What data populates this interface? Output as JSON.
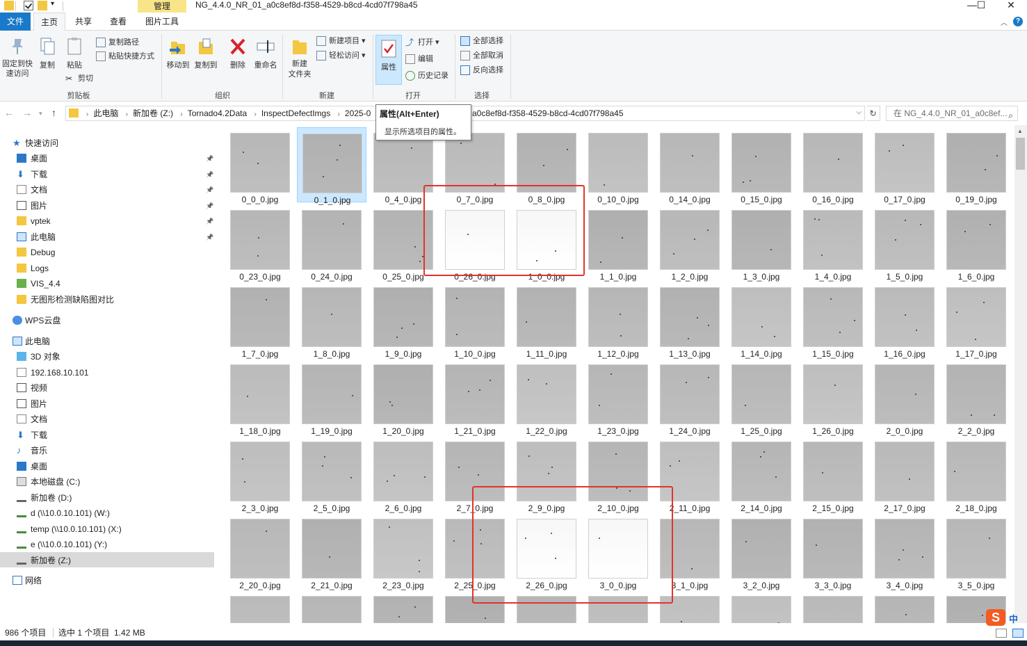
{
  "titlebar": {
    "manage_tab": "管理",
    "title": "NG_4.4.0_NR_01_a0c8ef8d-f358-4529-b8cd-4cd07f798a45",
    "minimize": "—",
    "maximize": "☐",
    "close": "✕"
  },
  "tabs": {
    "file": "文件",
    "home": "主页",
    "share": "共享",
    "view": "查看",
    "picture_tools": "图片工具"
  },
  "ribbon": {
    "pin_quick": "固定到快\n速访问",
    "copy": "复制",
    "paste": "粘贴",
    "copy_path": "复制路径",
    "paste_shortcut": "粘贴快捷方式",
    "cut": "剪切",
    "group_clipboard": "剪贴板",
    "move_to": "移动到",
    "copy_to": "复制到",
    "delete": "删除",
    "rename": "重命名",
    "group_organize": "组织",
    "new_folder": "新建\n文件夹",
    "new_item": "新建项目",
    "easy_access": "轻松访问",
    "group_new": "新建",
    "properties": "属性",
    "open": "打开",
    "edit": "编辑",
    "history": "历史记录",
    "group_open": "打开",
    "select_all": "全部选择",
    "select_none": "全部取消",
    "invert_selection": "反向选择",
    "group_select": "选择"
  },
  "address": {
    "crumbs": [
      "此电脑",
      "新加卷 (Z:)",
      "Tornado4.2Data",
      "InspectDefectImgs",
      "2025-0"
    ],
    "tail": "a0c8ef8d-f358-4529-b8cd-4cd07f798a45",
    "search_placeholder": "在 NG_4.4.0_NR_01_a0c8ef..."
  },
  "tooltip": {
    "title": "属性(Alt+Enter)",
    "desc": "显示所选项目的属性。"
  },
  "navpane": {
    "quick_access": "快速访问",
    "quick_items": [
      "桌面",
      "下载",
      "文档",
      "图片",
      "vptek",
      "此电脑",
      "Debug",
      "Logs",
      "VIS_4.4",
      "无图形检测缺陷图对比"
    ],
    "wps": "WPS云盘",
    "this_pc": "此电脑",
    "pc_items": [
      "3D 对象",
      "192.168.10.101",
      "视频",
      "图片",
      "文档",
      "下载",
      "音乐",
      "桌面",
      "本地磁盘 (C:)",
      "新加卷 (D:)",
      "d (\\\\10.0.10.101) (W:)",
      "temp (\\\\10.0.10.101) (X:)",
      "e (\\\\10.0.10.101) (Y:)",
      "新加卷 (Z:)"
    ],
    "network": "网络"
  },
  "files": [
    [
      "0_0_0.jpg",
      "0_1_0.jpg",
      "0_4_0.jpg",
      "0_7_0.jpg",
      "0_8_0.jpg",
      "0_10_0.jpg",
      "0_14_0.jpg",
      "0_15_0.jpg",
      "0_16_0.jpg",
      "0_17_0.jpg",
      "0_19_0.jpg"
    ],
    [
      "0_23_0.jpg",
      "0_24_0.jpg",
      "0_25_0.jpg",
      "0_26_0.jpg",
      "1_0_0.jpg",
      "1_1_0.jpg",
      "1_2_0.jpg",
      "1_3_0.jpg",
      "1_4_0.jpg",
      "1_5_0.jpg",
      "1_6_0.jpg"
    ],
    [
      "1_7_0.jpg",
      "1_8_0.jpg",
      "1_9_0.jpg",
      "1_10_0.jpg",
      "1_11_0.jpg",
      "1_12_0.jpg",
      "1_13_0.jpg",
      "1_14_0.jpg",
      "1_15_0.jpg",
      "1_16_0.jpg",
      "1_17_0.jpg"
    ],
    [
      "1_18_0.jpg",
      "1_19_0.jpg",
      "1_20_0.jpg",
      "1_21_0.jpg",
      "1_22_0.jpg",
      "1_23_0.jpg",
      "1_24_0.jpg",
      "1_25_0.jpg",
      "1_26_0.jpg",
      "2_0_0.jpg",
      "2_2_0.jpg"
    ],
    [
      "2_3_0.jpg",
      "2_5_0.jpg",
      "2_6_0.jpg",
      "2_7_0.jpg",
      "2_9_0.jpg",
      "2_10_0.jpg",
      "2_11_0.jpg",
      "2_14_0.jpg",
      "2_15_0.jpg",
      "2_17_0.jpg",
      "2_18_0.jpg"
    ],
    [
      "2_20_0.jpg",
      "2_21_0.jpg",
      "2_23_0.jpg",
      "2_25_0.jpg",
      "2_26_0.jpg",
      "3_0_0.jpg",
      "3_1_0.jpg",
      "3_2_0.jpg",
      "3_3_0.jpg",
      "3_4_0.jpg",
      "3_5_0.jpg"
    ],
    [
      "",
      "",
      "",
      "",
      "",
      "",
      "",
      "",
      "",
      "",
      ""
    ]
  ],
  "white_thumbs": [
    "0_26_0.jpg",
    "1_0_0.jpg",
    "2_26_0.jpg",
    "3_0_0.jpg"
  ],
  "selected_file": "0_1_0.jpg",
  "status": {
    "count": "986 个项目",
    "selection": "选中 1 个项目  1.42 MB"
  },
  "ime": {
    "logo": "S",
    "mode": "中"
  },
  "colors": {
    "accent": "#1979ca",
    "manage_tab": "#f8e58a",
    "selection": "#cce8ff",
    "annotation_red": "#e0342b"
  }
}
